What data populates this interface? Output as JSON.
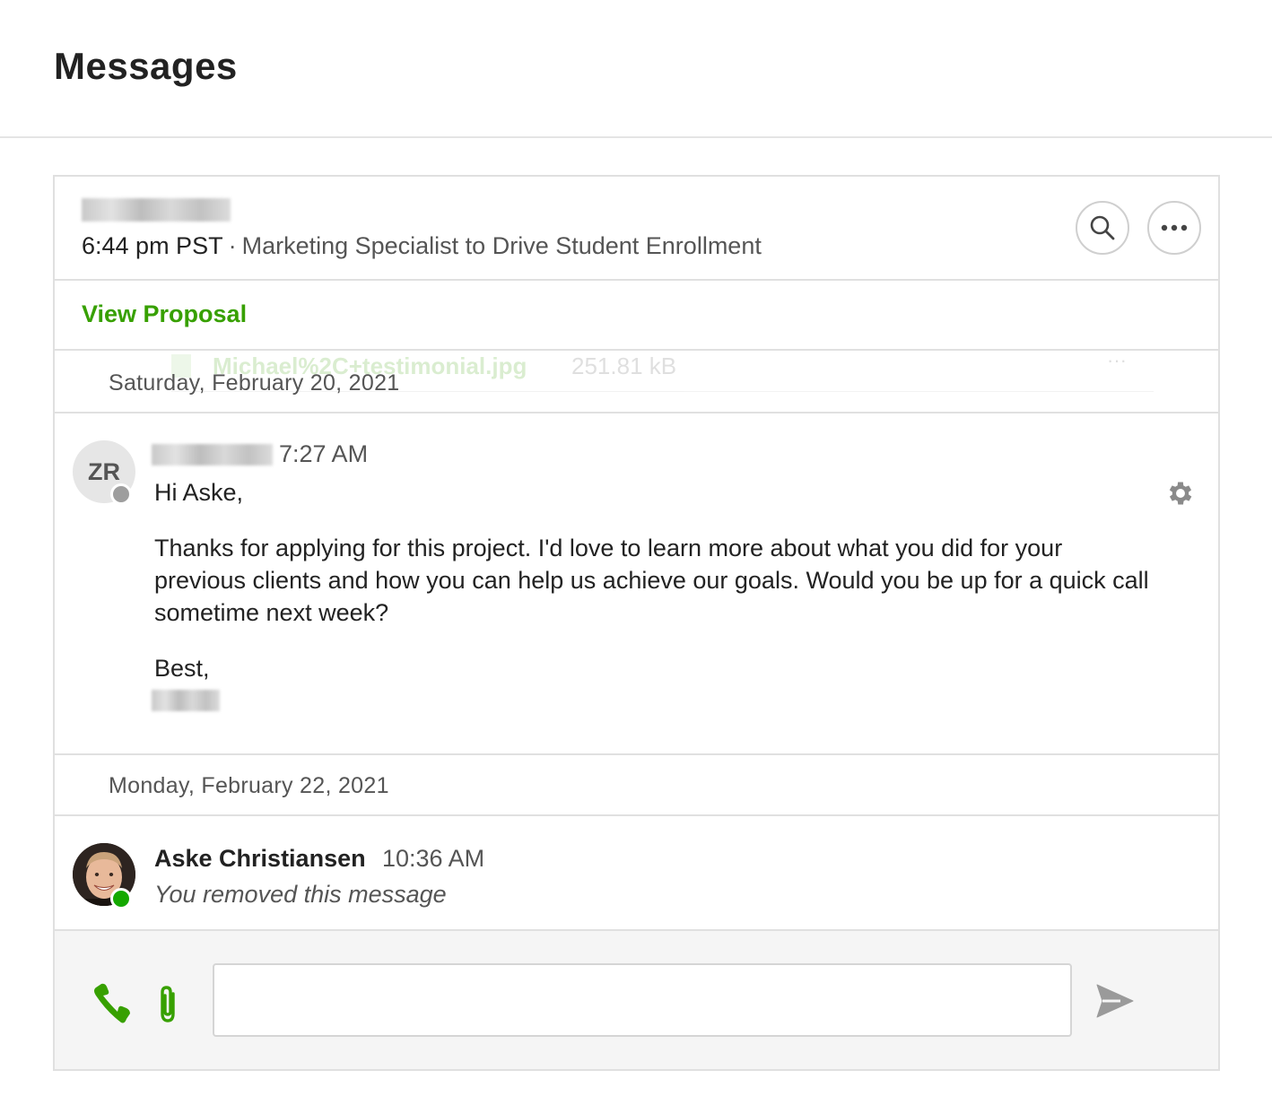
{
  "page": {
    "title": "Messages"
  },
  "conversation": {
    "time": "6:44 pm PST",
    "separator": "·",
    "job_title": "Marketing Specialist to Drive Student Enrollment",
    "search_icon": "search-icon",
    "more_icon": "more-horizontal-icon"
  },
  "proposal": {
    "link_label": "View Proposal"
  },
  "ghost_attachment": {
    "filename": "Michael%2C+testimonial.jpg",
    "size": "251.81 kB",
    "menu": "···"
  },
  "thread": {
    "date_1": "Saturday, February 20, 2021",
    "date_2": "Monday, February 22, 2021"
  },
  "message_1": {
    "avatar_initials": "ZR",
    "time": "7:27 AM",
    "greeting": "Hi Aske,",
    "body": "Thanks for applying for this project. I'd love to learn more about what you did for your previous clients and how you can help us achieve our goals. Would you be up for a quick call sometime next week?",
    "closing": "Best,"
  },
  "message_2": {
    "sender": "Aske Christiansen",
    "time": "10:36 AM",
    "text": "You removed this message"
  },
  "composer": {
    "input_value": "",
    "placeholder": ""
  },
  "colors": {
    "accent_green": "#37a000",
    "online_green": "#14a800",
    "offline_gray": "#9e9e9e",
    "border": "#e0e0e0"
  }
}
